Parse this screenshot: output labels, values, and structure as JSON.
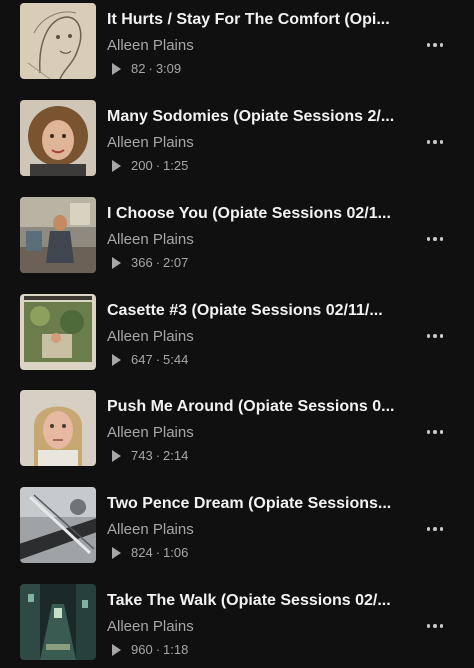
{
  "tracks": [
    {
      "title": "It Hurts / Stay For The Comfort (Opi...",
      "artist": "Alleen Plains",
      "plays": "82",
      "duration": "3:09",
      "art": "drawing-of-face"
    },
    {
      "title": "Many Sodomies (Opiate Sessions 2/...",
      "artist": "Alleen Plains",
      "plays": "200",
      "duration": "1:25",
      "art": "portrait-curly-hair"
    },
    {
      "title": "I Choose You (Opiate Sessions 02/1...",
      "artist": "Alleen Plains",
      "plays": "366",
      "duration": "2:07",
      "art": "woman-in-room"
    },
    {
      "title": "Casette #3 (Opiate Sessions 02/11/...",
      "artist": "Alleen Plains",
      "plays": "647",
      "duration": "5:44",
      "art": "album-cover-greenery"
    },
    {
      "title": "Push Me Around (Opiate Sessions 0...",
      "artist": "Alleen Plains",
      "plays": "743",
      "duration": "2:14",
      "art": "portrait-blond-man"
    },
    {
      "title": "Two Pence Dream (Opiate Sessions...",
      "artist": "Alleen Plains",
      "plays": "824",
      "duration": "1:06",
      "art": "turntable-closeup"
    },
    {
      "title": "Take The Walk (Opiate Sessions 02/...",
      "artist": "Alleen Plains",
      "plays": "960",
      "duration": "1:18",
      "art": "night-alley"
    }
  ],
  "separator": "·",
  "colors": {
    "background": "#101010",
    "title": "#f2f2f2",
    "secondary": "#a6a6a6"
  }
}
